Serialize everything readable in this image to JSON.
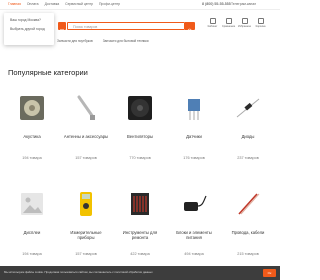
{
  "topbar": {
    "nav": [
      "Главная",
      "Оплата",
      "Доставка",
      "Сервисный центр",
      "Профи-центр"
    ],
    "phone": "8 (800) 55-55-555",
    "telegram": "Телеграм-канал"
  },
  "location_popup": {
    "question": "Ваш город Москва?",
    "select_label": "Выбрать другой город"
  },
  "search": {
    "placeholder": "Поиск товаров"
  },
  "header_icons": [
    {
      "label": "Кабинет",
      "icon": "user-icon"
    },
    {
      "label": "Сравнение",
      "icon": "compare-icon"
    },
    {
      "label": "Избранное",
      "icon": "heart-icon"
    },
    {
      "label": "Корзина",
      "icon": "cart-icon"
    }
  ],
  "subnav": [
    "Запчасти для ноутбуков",
    "Запчасти для бытовой техники"
  ],
  "section_title": "Популярные категории",
  "categories": [
    {
      "name": "Акустика",
      "count": "194 товара"
    },
    {
      "name": "Антенны и аксессуары",
      "count": "157 товаров"
    },
    {
      "name": "Вентиляторы",
      "count": "770 товаров"
    },
    {
      "name": "Датчики",
      "count": "176 товаров"
    },
    {
      "name": "Диоды",
      "count": "237 товаров"
    },
    {
      "name": "Дисплеи",
      "count": "194 товара"
    },
    {
      "name": "Измерительные приборы",
      "count": "157 товаров"
    },
    {
      "name": "Инструменты для ремонта",
      "count": "422 товара"
    },
    {
      "name": "Блоки и элементы питания",
      "count": "494 товара"
    },
    {
      "name": "Провода, кабели",
      "count": "215 товаров"
    }
  ],
  "cookie": {
    "text": "Мы используем файлы cookie. Продолжая пользоваться сайтом, вы соглашаетесь с политикой обработки данных.",
    "button": "Ок"
  },
  "colors": {
    "accent": "#f05a1a",
    "cookie_bg": "#3d3d3d"
  }
}
